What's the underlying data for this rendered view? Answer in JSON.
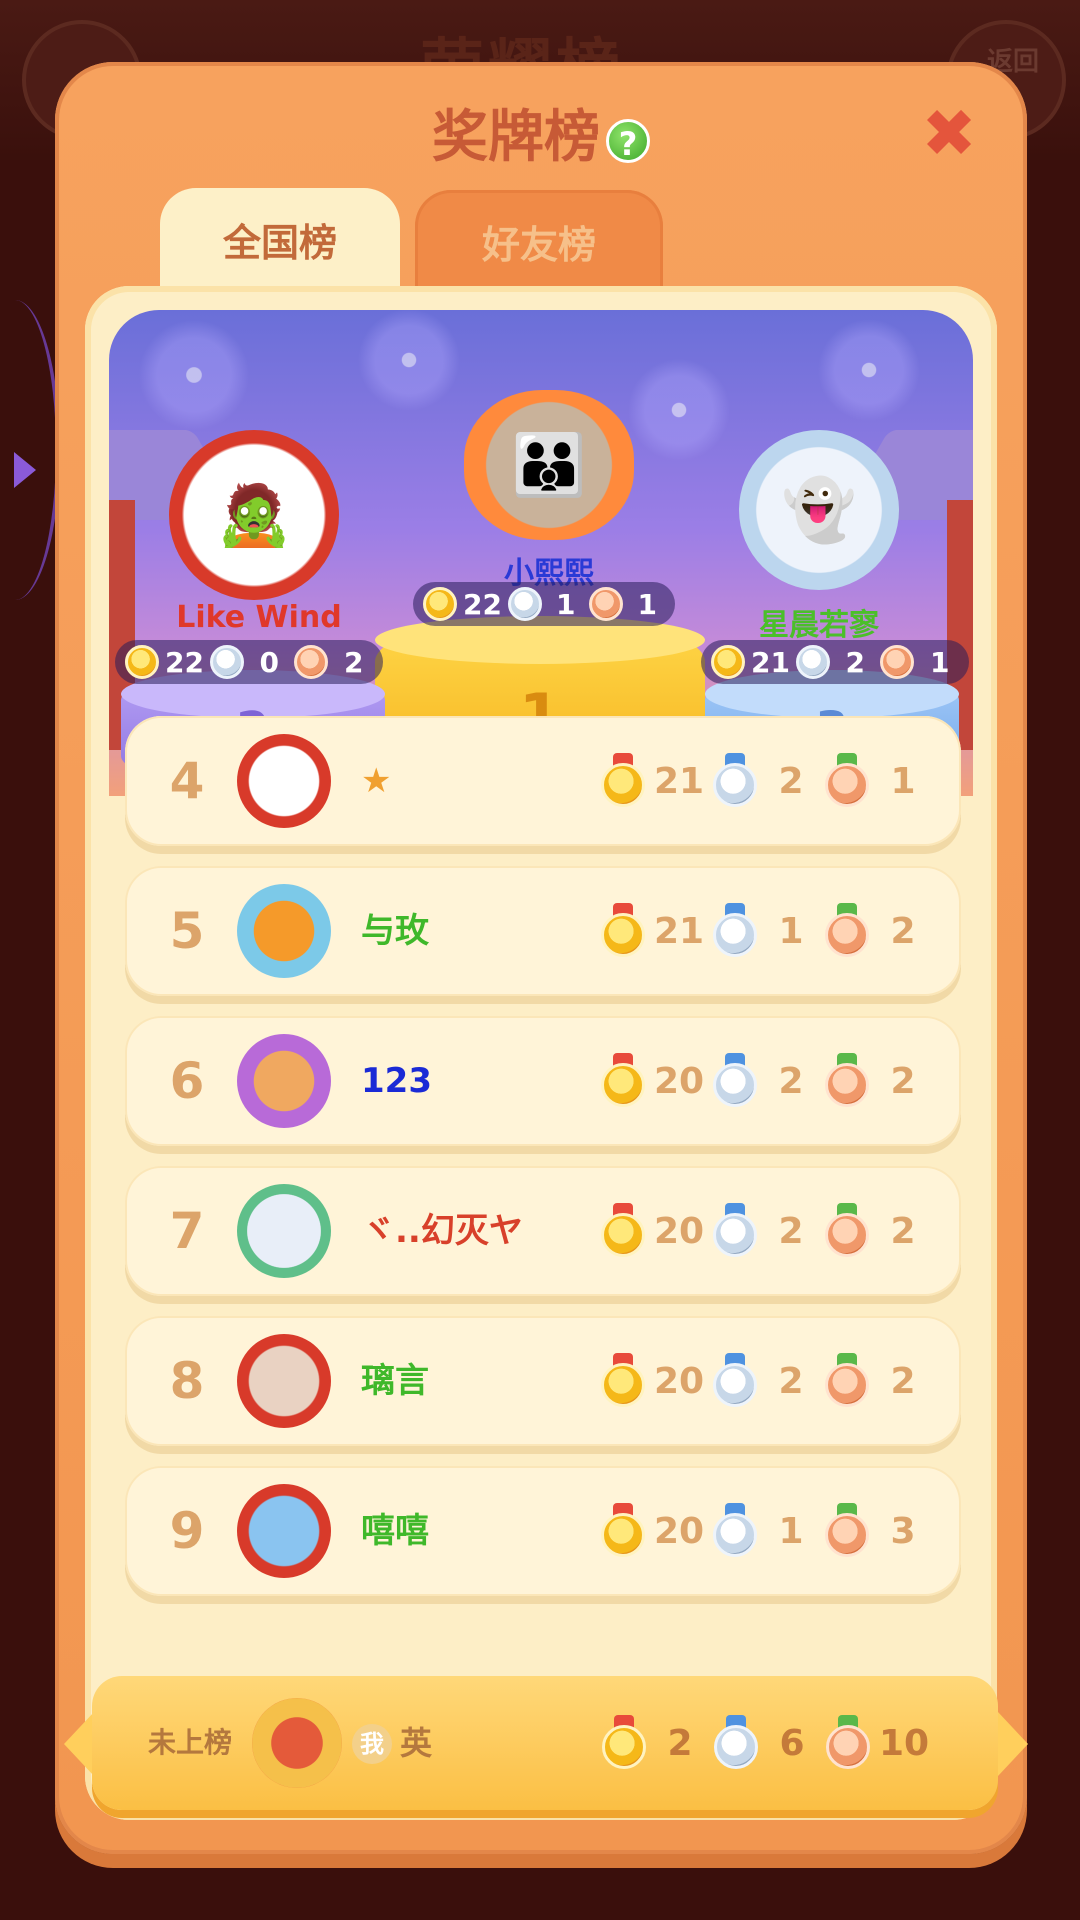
{
  "background": {
    "title": "荣耀榜",
    "back_label": "返回"
  },
  "panel": {
    "title": "奖牌榜",
    "help_icon": "?",
    "close_icon": "✖"
  },
  "tabs": [
    {
      "label": "全国榜",
      "active": true
    },
    {
      "label": "好友榜",
      "active": false
    }
  ],
  "podium": [
    {
      "rank": "1",
      "name": "小熙熙",
      "gold": "22",
      "silver": "1",
      "bronze": "1",
      "name_color": "#2a3ad6"
    },
    {
      "rank": "2",
      "name": "Like  Wind",
      "gold": "22",
      "silver": "0",
      "bronze": "2",
      "name_color": "#e0382a"
    },
    {
      "rank": "3",
      "name": "星晨若寥",
      "gold": "21",
      "silver": "2",
      "bronze": "1",
      "name_color": "#4bbf2a"
    }
  ],
  "rows": [
    {
      "rank": "4",
      "name": "★",
      "name_color": "#f0a030",
      "gold": "21",
      "silver": "2",
      "bronze": "1",
      "avatar_icon": "straw-hat-avatar"
    },
    {
      "rank": "5",
      "name": "与玫",
      "name_color": "#3fb82a",
      "gold": "21",
      "silver": "1",
      "bronze": "2",
      "avatar_icon": "sun-avatar"
    },
    {
      "rank": "6",
      "name": "123",
      "name_color": "#1a2ad6",
      "gold": "20",
      "silver": "2",
      "bronze": "2",
      "avatar_icon": "rap-cat-avatar"
    },
    {
      "rank": "7",
      "name": "ヾ..幻灭ヤ",
      "name_color": "#d8402a",
      "gold": "20",
      "silver": "2",
      "bronze": "2",
      "avatar_icon": "photo-avatar"
    },
    {
      "rank": "8",
      "name": "璃言",
      "name_color": "#3fb82a",
      "gold": "20",
      "silver": "2",
      "bronze": "2",
      "avatar_icon": "photo-avatar"
    },
    {
      "rank": "9",
      "name": "嘻嘻",
      "name_color": "#3fb82a",
      "gold": "20",
      "silver": "1",
      "bronze": "3",
      "avatar_icon": "penguin-avatar"
    }
  ],
  "me": {
    "rank_label": "未上榜",
    "badge": "我",
    "name": "英",
    "gold": "2",
    "silver": "6",
    "bronze": "10"
  },
  "colors": {
    "panel": "#f7a25e",
    "content": "#fdeec6",
    "row": "#fff4d8",
    "rank_text": "#dca46a",
    "title": "#c75a36"
  }
}
